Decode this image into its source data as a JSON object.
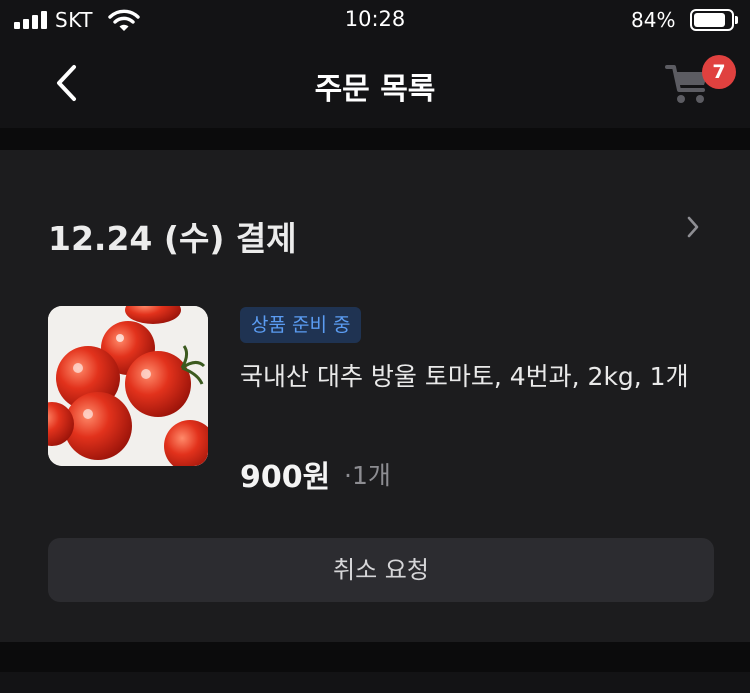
{
  "status_bar": {
    "carrier": "SKT",
    "time": "10:28",
    "battery_percent": "84%",
    "battery_level": 0.84
  },
  "header": {
    "title": "주문 목록",
    "cart_count": "7"
  },
  "order": {
    "date_label": "12.24 (수) 결제",
    "status_badge": "상품 준비 중",
    "product_name": "국내산 대추 방울 토마토, 4번과, 2kg, 1개",
    "price": "900원",
    "quantity": "·1개",
    "cancel_label": "취소 요청"
  },
  "colors": {
    "background": "#131315",
    "card": "#1c1c1e",
    "badge_bg": "#1f3352",
    "badge_text": "#5b9cf2",
    "cart_badge": "#e0413f",
    "button_bg": "#2c2c30"
  },
  "icons": [
    "signal-icon",
    "wifi-icon",
    "battery-icon",
    "back-arrow-icon",
    "cart-icon",
    "chevron-right-icon"
  ]
}
